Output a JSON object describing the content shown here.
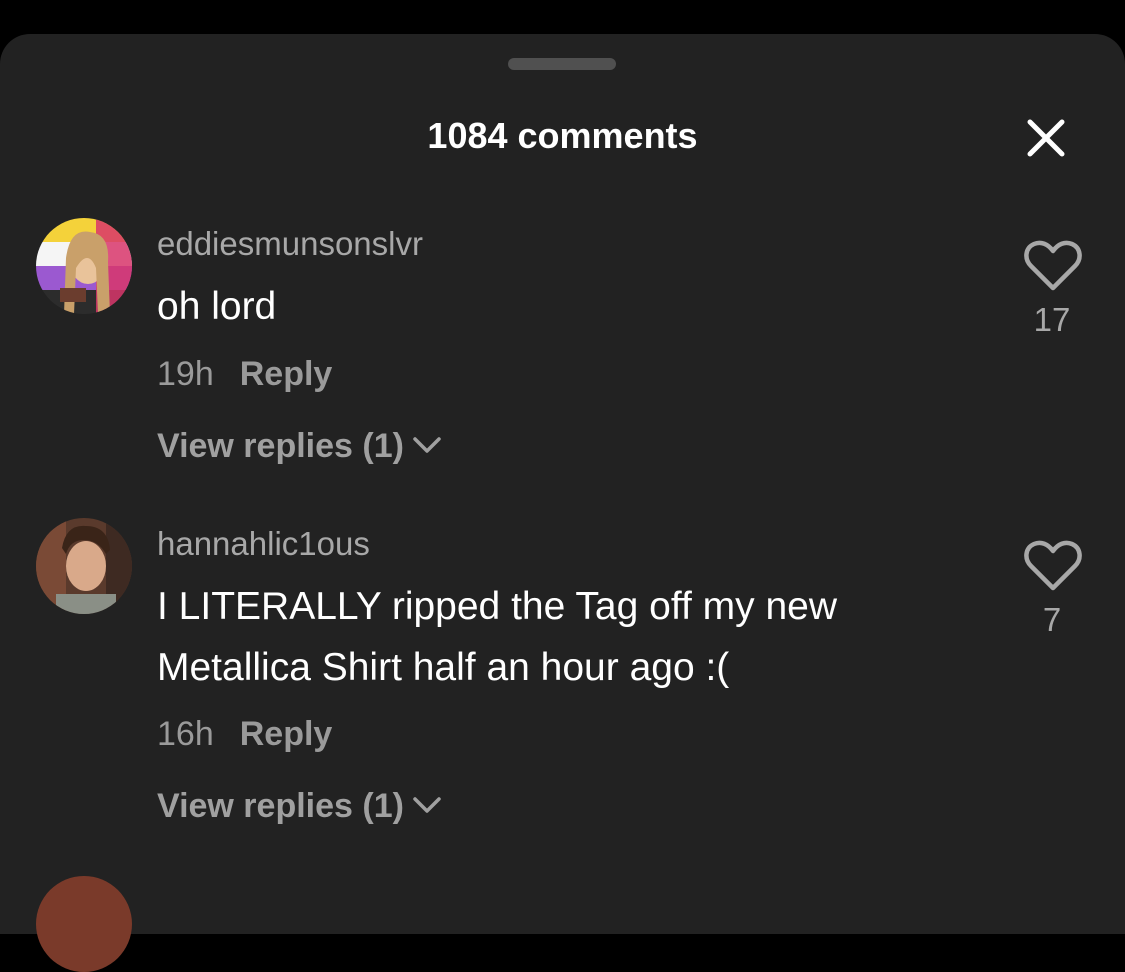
{
  "header": {
    "title": "1084 comments",
    "close_icon": "close-icon"
  },
  "comments": [
    {
      "username": "eddiesmunsonslvr",
      "text": "oh lord",
      "time": "19h",
      "reply_label": "Reply",
      "view_replies": "View replies (1)",
      "likes": "17",
      "like_icon": "heart-outline-icon"
    },
    {
      "username": "hannahlic1ous",
      "text": "I LITERALLY ripped the Tag off my new Metallica Shirt half an hour ago :(",
      "time": "16h",
      "reply_label": "Reply",
      "view_replies": "View replies (1)",
      "likes": "7",
      "like_icon": "heart-outline-icon"
    }
  ],
  "colors": {
    "sheet_background": "#222222",
    "primary_text": "#ffffff",
    "secondary_text": "#a8a8a8"
  }
}
